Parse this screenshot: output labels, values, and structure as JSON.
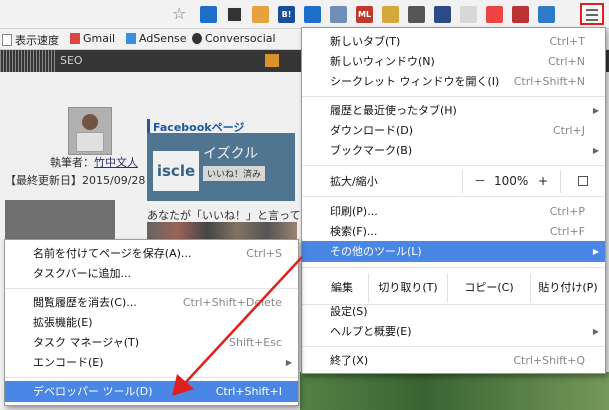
{
  "bookmarks_bar": {
    "items": [
      {
        "label": "表示速度",
        "icon": "page-icon"
      },
      {
        "label": "Gmail",
        "icon": "gmail-icon"
      },
      {
        "label": "AdSense",
        "icon": "adsense-icon"
      },
      {
        "label": "Conversocial",
        "icon": "conversocial-icon"
      }
    ]
  },
  "toolbar": {
    "extension_badges": [
      "B!",
      "ML"
    ],
    "menu_button_icon": "hamburger-menu-icon"
  },
  "page": {
    "site_nav": "SEO",
    "author_prefix": "執筆者：",
    "author_name": "竹中文人",
    "last_updated": "【最終更新日】2015/09/28",
    "fb_section_label": "Facebookページ",
    "fb_page_name": "イズクル",
    "fb_logo_text": "iscle",
    "fb_like": "いいね！済み",
    "fb_friends_text": "あなたが「いいね！」と言って"
  },
  "main_menu": {
    "items": [
      {
        "label": "新しいタブ(T)",
        "shortcut": "Ctrl+T"
      },
      {
        "label": "新しいウィンドウ(N)",
        "shortcut": "Ctrl+N"
      },
      {
        "label": "シークレット ウィンドウを開く(I)",
        "shortcut": "Ctrl+Shift+N"
      },
      {
        "label": "履歴と最近使ったタブ(H)",
        "shortcut": ""
      },
      {
        "label": "ダウンロード(D)",
        "shortcut": "Ctrl+J"
      },
      {
        "label": "ブックマーク(B)",
        "shortcut": ""
      },
      {
        "label": "拡大/縮小",
        "shortcut": ""
      },
      {
        "label": "印刷(P)...",
        "shortcut": "Ctrl+P"
      },
      {
        "label": "検索(F)...",
        "shortcut": "Ctrl+F"
      },
      {
        "label": "その他のツール(L)",
        "shortcut": ""
      },
      {
        "label": "設定(S)",
        "shortcut": ""
      },
      {
        "label": "ヘルプと概要(E)",
        "shortcut": ""
      },
      {
        "label": "終了(X)",
        "shortcut": "Ctrl+Shift+Q"
      }
    ],
    "zoom": {
      "minus": "－",
      "value": "100%",
      "plus": "+"
    },
    "edit": {
      "label": "編集",
      "cut": "切り取り(T)",
      "copy": "コピー(C)",
      "paste": "貼り付け(P)"
    }
  },
  "sub_menu": {
    "items": [
      {
        "label": "名前を付けてページを保存(A)...",
        "shortcut": "Ctrl+S"
      },
      {
        "label": "タスクバーに追加...",
        "shortcut": ""
      },
      {
        "label": "閲覧履歴を消去(C)...",
        "shortcut": "Ctrl+Shift+Delete"
      },
      {
        "label": "拡張機能(E)",
        "shortcut": ""
      },
      {
        "label": "タスク マネージャ(T)",
        "shortcut": "Shift+Esc"
      },
      {
        "label": "エンコード(E)",
        "shortcut": ""
      },
      {
        "label": "デベロッパー ツール(D)",
        "shortcut": "Ctrl+Shift+I"
      }
    ]
  },
  "colors": {
    "highlight": "#4a87e4",
    "annotation_red": "#e0201e"
  }
}
